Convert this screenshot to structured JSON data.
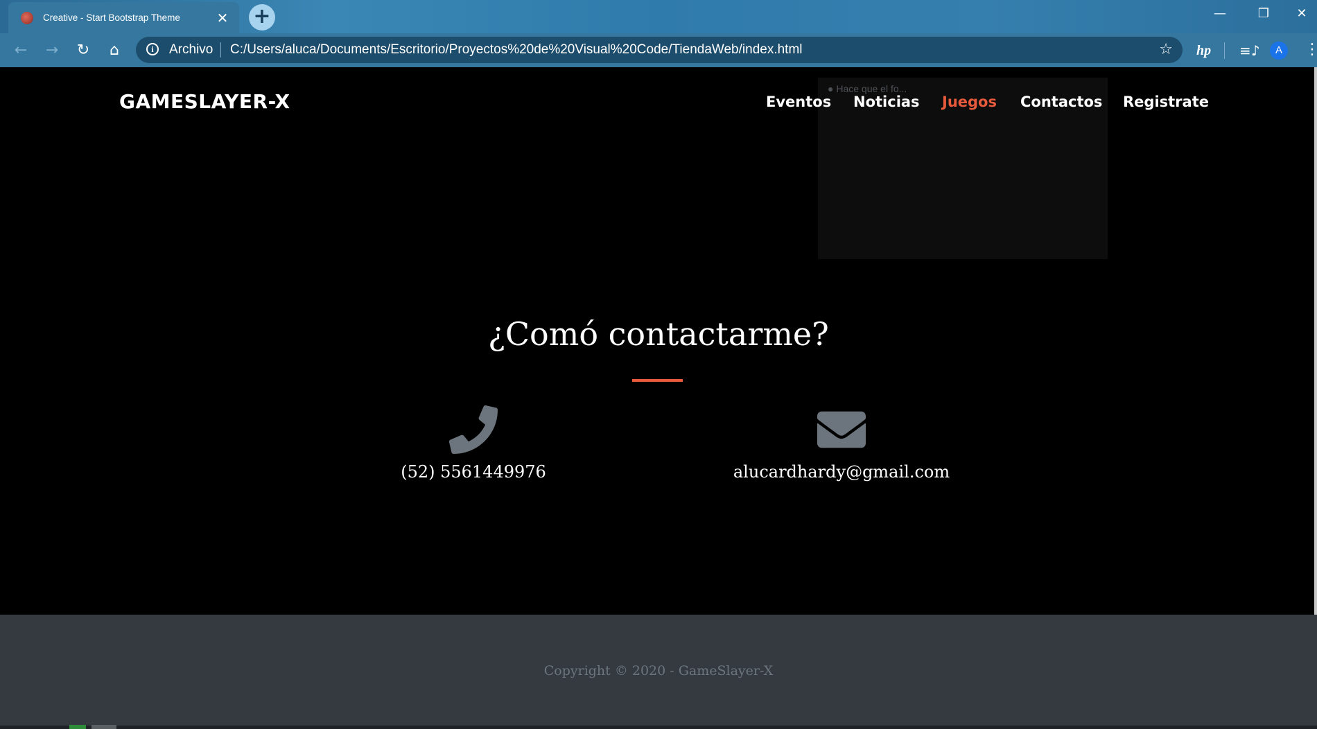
{
  "browser": {
    "tab_title": "Creative - Start Bootstrap Theme",
    "tab_close": "✕",
    "new_tab": "+",
    "scheme_label": "Archivo",
    "url": "C:/Users/aluca/Documents/Escritorio/Proyectos%20de%20Visual%20Code/TiendaWeb/index.html",
    "window_controls": {
      "minimize": "—",
      "restore": "❐",
      "close": "✕"
    },
    "profile_initial": "A",
    "toolbar_icons": {
      "back": "←",
      "forward": "→",
      "reload": "↻",
      "home": "⌂",
      "star": "☆",
      "hp": "hp",
      "playlist": "≡♪",
      "menu": "⋮",
      "info": "i"
    }
  },
  "overlay": {
    "text": "● Hace que el fo..."
  },
  "page": {
    "brand": "GAMESLAYER-X",
    "nav": [
      {
        "label": "Eventos"
      },
      {
        "label": "Noticias"
      },
      {
        "label": "Juegos",
        "active": true
      },
      {
        "label": "Contactos"
      },
      {
        "label": "Registrate"
      }
    ],
    "contact": {
      "title": "¿Comó contactarme?",
      "phone": "(52) 5561449976",
      "email": "alucardhardy@gmail.com",
      "phone_icon": "phone-icon",
      "email_icon": "envelope-icon"
    },
    "footer": {
      "copyright": "Copyright © 2020 - GameSlayer-X"
    }
  },
  "colors": {
    "accent": "#e85a3c",
    "footer_bg": "#343a40",
    "footer_text": "#6c757d",
    "icon_gray": "#6c757d",
    "chrome_frame": "#35779f"
  }
}
